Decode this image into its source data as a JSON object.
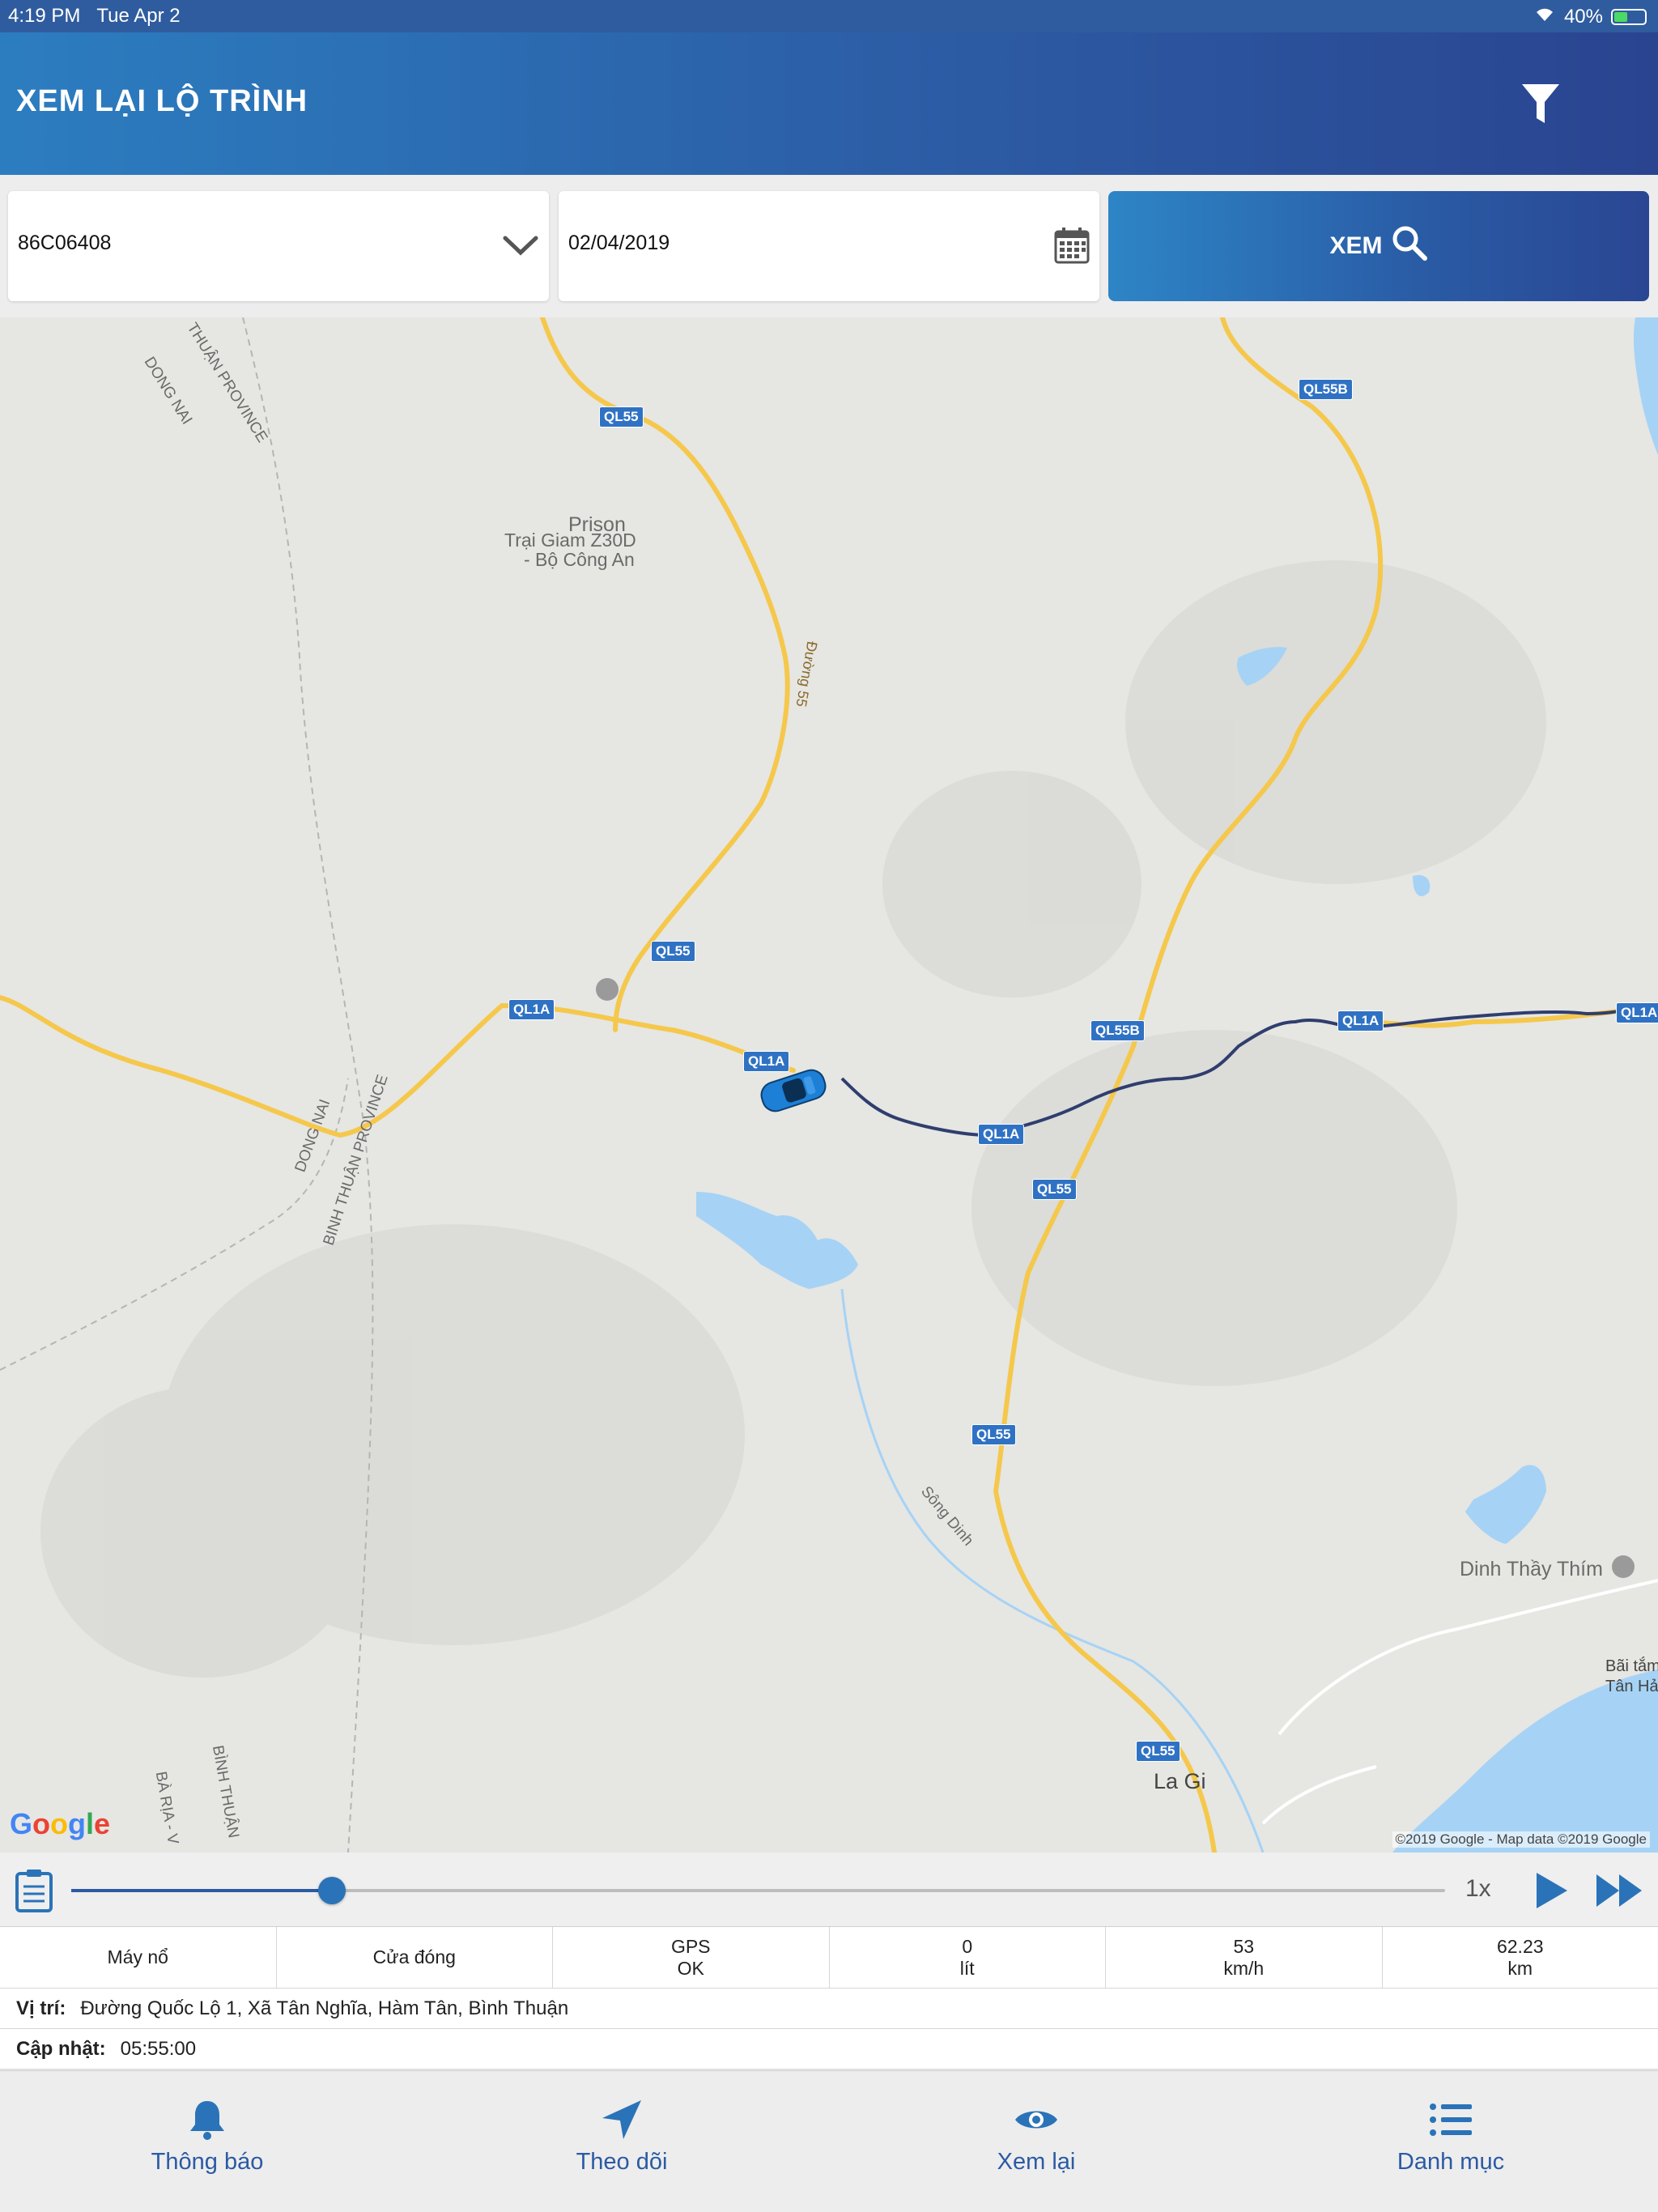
{
  "status_bar": {
    "time": "4:19 PM",
    "date": "Tue Apr 2",
    "battery": "40%"
  },
  "header": {
    "title": "XEM LẠI LỘ TRÌNH",
    "filter_icon": "filter-icon"
  },
  "filters": {
    "vehicle": "86C06408",
    "date": "02/04/2019",
    "view_button": "XEM"
  },
  "map": {
    "labels": {
      "prison": "Prison",
      "prison_name_1": "Trại Giam Z30D",
      "prison_name_2": "- Bộ Công An",
      "dinh": "Dinh Thầy Thím",
      "la_gi": "La Gi",
      "bai_tam_1": "Bãi tắm",
      "bai_tam_2": "Tân Hả",
      "dong_nai_top": "DONG NAI",
      "thuan_province_top": "THUẬN PROVINCE",
      "dong_nai_mid": "DONG NAI",
      "binh_thuan_province": "BINH THUẬN PROVINCE",
      "ba_ria": "BÀ RỊA - V",
      "binh_thuan_bottom": "BÌNH THUẬN",
      "song_dinh": "Sông Dinh",
      "duong_55": "Đường 55"
    },
    "shields": {
      "ql55_a": "QL55",
      "ql55b_a": "QL55B",
      "ql55_b": "QL55",
      "ql1a_a": "QL1A",
      "ql1a_b": "QL1A",
      "ql55b_b": "QL55B",
      "ql1a_c": "QL1A",
      "ql1a_d": "QL1A",
      "ql1a_e": "QL1A",
      "ql55_c": "QL55",
      "ql55_d": "QL55",
      "ql55_e": "QL55"
    },
    "google": "Google",
    "attribution": "©2019 Google - Map data ©2019 Google"
  },
  "playback": {
    "speed": "1x",
    "progress": 0.19
  },
  "stats": [
    {
      "line1": "Máy nổ",
      "line2": ""
    },
    {
      "line1": "Cửa đóng",
      "line2": ""
    },
    {
      "line1": "GPS",
      "line2": "OK"
    },
    {
      "line1": "0",
      "line2": "lít"
    },
    {
      "line1": "53",
      "line2": "km/h"
    },
    {
      "line1": "62.23",
      "line2": "km"
    }
  ],
  "location": {
    "label": "Vị trí:",
    "value": "Đường Quốc Lộ 1, Xã Tân Nghĩa, Hàm Tân, Bình Thuận"
  },
  "updated": {
    "label": "Cập nhật:",
    "value": "05:55:00"
  },
  "tabs": [
    {
      "label": "Thông báo",
      "icon": "bell-icon"
    },
    {
      "label": "Theo dõi",
      "icon": "navigation-arrow-icon"
    },
    {
      "label": "Xem lại",
      "icon": "eye-icon"
    },
    {
      "label": "Danh mục",
      "icon": "list-icon"
    }
  ],
  "colors": {
    "header": "#2c5aa3",
    "accent": "#2a73b8",
    "route": "#2f3e6e",
    "road": "#f5c84c"
  }
}
